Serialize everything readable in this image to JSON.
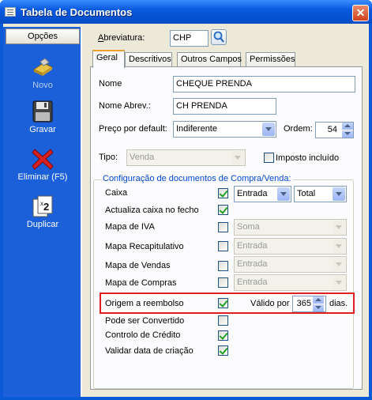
{
  "window": {
    "title": "Tabela de Documentos",
    "close_glyph": "✕"
  },
  "sidebar": {
    "header": "Opções",
    "actions": [
      {
        "label": "Novo",
        "icon": "new-icon",
        "enabled": false
      },
      {
        "label": "Gravar",
        "icon": "floppy-disk-icon",
        "enabled": true
      },
      {
        "label": "Eliminar (F5)",
        "icon": "delete-x-icon",
        "enabled": true
      },
      {
        "label": "Duplicar",
        "icon": "duplicate-icon",
        "enabled": true
      }
    ]
  },
  "header": {
    "abreviatura_label": "Abreviatura:",
    "abreviatura_value": "CHP"
  },
  "tabs": [
    "Geral",
    "Descritivos",
    "Outros Campos",
    "Permissões"
  ],
  "form": {
    "nome_label": "Nome",
    "nome_value": "CHEQUE PRENDA",
    "nome_abrev_label": "Nome Abrev.:",
    "nome_abrev_value": "CH PRENDA",
    "preco_label": "Preço por default:",
    "preco_value": "Indiferente",
    "ordem_label": "Ordem:",
    "ordem_value": "54",
    "tipo_label": "Tipo:",
    "tipo_value": "Venda",
    "imposto_label": "Imposto incluído"
  },
  "config": {
    "legend": "Configuração de documentos de Compra/Venda:",
    "rows": [
      {
        "label": "Caixa",
        "checked": true,
        "select1": "Entrada",
        "select2": "Total"
      },
      {
        "label": "Actualiza caixa no fecho",
        "checked": true
      },
      {
        "label": "Mapa de IVA",
        "checked": false,
        "select1": "Soma"
      },
      {
        "label": "Mapa Recapitulativo",
        "checked": false,
        "select1": "Entrada"
      },
      {
        "label": "Mapa de Vendas",
        "checked": false,
        "select1": "Entrada"
      },
      {
        "label": "Mapa de Compras",
        "checked": false,
        "select1": "Entrada"
      },
      {
        "label": "Origem a reembolso",
        "checked": true,
        "valido_label": "Válido por",
        "valido_value": "365",
        "dias_label": "dias."
      },
      {
        "label": "Pode ser Convertido",
        "checked": false
      },
      {
        "label": "Controlo de Crédito",
        "checked": true
      },
      {
        "label": "Validar data de criação",
        "checked": true
      }
    ]
  },
  "colors": {
    "title_bar": "#0a5ae0",
    "sidebar": "#1b60d9",
    "highlight": "#e02020",
    "legend": "#0046d5"
  }
}
